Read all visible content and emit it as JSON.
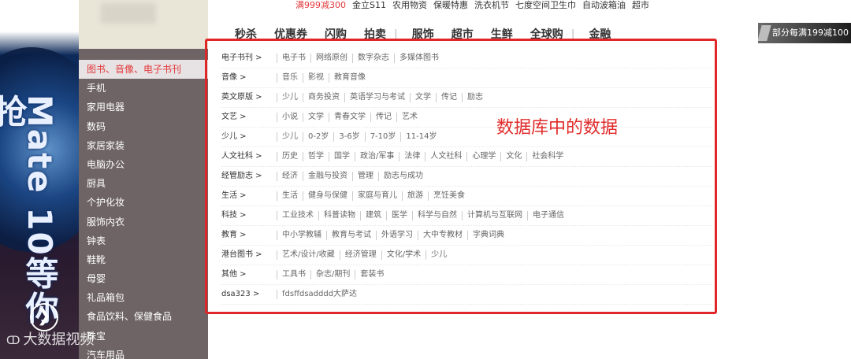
{
  "banner": {
    "text": "Mate 10等你抢",
    "arrow": "❯"
  },
  "top_links": [
    {
      "label": "满999减300",
      "highlight": true
    },
    {
      "label": "金立S11"
    },
    {
      "label": "农用物资"
    },
    {
      "label": "保暖特惠"
    },
    {
      "label": "洗衣机节"
    },
    {
      "label": "七度空间卫生巾"
    },
    {
      "label": "自动波箱油"
    },
    {
      "label": "超市"
    }
  ],
  "main_nav": [
    "秒杀",
    "优惠券",
    "闪购",
    "拍卖",
    "服饰",
    "超市",
    "生鲜",
    "全球购",
    "金融"
  ],
  "promo_chip": "部分每满199减100",
  "categories": [
    "图书、音像、电子书刊",
    "手机",
    "家用电器",
    "数码",
    "家居家装",
    "电脑办公",
    "厨具",
    "个护化妆",
    "服饰内衣",
    "钟表",
    "鞋靴",
    "母婴",
    "礼品箱包",
    "食品饮料、保健食品",
    "珠宝",
    "汽车用品"
  ],
  "submenu": [
    {
      "name": "电子书刊 >",
      "links": [
        "电子书",
        "网络原创",
        "数字杂志",
        "多媒体图书"
      ]
    },
    {
      "name": "音像 >",
      "links": [
        "音乐",
        "影视",
        "教育音像"
      ]
    },
    {
      "name": "英文原版 >",
      "links": [
        "少儿",
        "商务投资",
        "英语学习与考试",
        "文学",
        "传记",
        "励志"
      ]
    },
    {
      "name": "文艺 >",
      "links": [
        "小说",
        "文学",
        "青春文学",
        "传记",
        "艺术"
      ]
    },
    {
      "name": "少儿 >",
      "links": [
        "少儿",
        "0-2岁",
        "3-6岁",
        "7-10岁",
        "11-14岁"
      ]
    },
    {
      "name": "人文社科 >",
      "links": [
        "历史",
        "哲学",
        "国学",
        "政治/军事",
        "法律",
        "人文社科",
        "心理学",
        "文化",
        "社会科学"
      ]
    },
    {
      "name": "经管励志 >",
      "links": [
        "经济",
        "金融与投资",
        "管理",
        "励志与成功"
      ]
    },
    {
      "name": "生活 >",
      "links": [
        "生活",
        "健身与保健",
        "家庭与育儿",
        "旅游",
        "烹饪美食"
      ]
    },
    {
      "name": "科技 >",
      "links": [
        "工业技术",
        "科普读物",
        "建筑",
        "医学",
        "科学与自然",
        "计算机与互联网",
        "电子通信"
      ]
    },
    {
      "name": "教育 >",
      "links": [
        "中小学教辅",
        "教育与考试",
        "外语学习",
        "大中专教材",
        "字典词典"
      ]
    },
    {
      "name": "港台图书 >",
      "links": [
        "艺术/设计/收藏",
        "经济管理",
        "文化/学术",
        "少儿"
      ]
    },
    {
      "name": "其他 >",
      "links": [
        "工具书",
        "杂志/期刊",
        "套装书"
      ]
    },
    {
      "name": "dsa323 >",
      "links": [
        "fdsffdsadddd大萨达"
      ]
    }
  ],
  "overlay_label": "数据库中的数据",
  "watermark": {
    "icon": "ↀ",
    "text": "大数据视频"
  },
  "colors": {
    "accent": "#e4393c",
    "frame": "#e02626",
    "sidebar": "#6e6466"
  }
}
